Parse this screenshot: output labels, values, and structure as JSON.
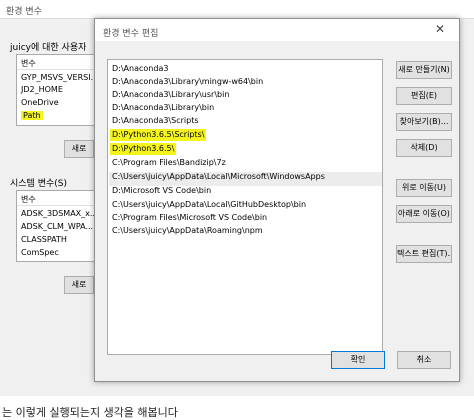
{
  "back_dialog": {
    "title": "환경 변수",
    "user_section_label": "juicy에 대한 사용자",
    "user_list_header": "변수",
    "user_vars": [
      "GYP_MSVS_VERSI...",
      "JD2_HOME",
      "OneDrive",
      "Path"
    ],
    "user_new_button": "새로",
    "system_section_label": "시스템 변수(S)",
    "system_list_header": "변수",
    "system_vars": [
      "ADSK_3DSMAX_x...",
      "ADSK_CLM_WPA...",
      "CLASSPATH",
      "ComSpec"
    ],
    "system_new_button": "새로"
  },
  "edit_dialog": {
    "title": "환경 변수 편집",
    "close_icon": "close-icon",
    "paths": [
      "D:\\Anaconda3",
      "D:\\Anaconda3\\Library\\mingw-w64\\bin",
      "D:\\Anaconda3\\Library\\usr\\bin",
      "D:\\Anaconda3\\Library\\bin",
      "D:\\Anaconda3\\Scripts",
      "D:\\Python3.6.5\\Scripts\\",
      "D:\\Python3.6.5\\",
      "C:\\Program Files\\Bandizip\\7z",
      "C:\\Users\\juicy\\AppData\\Local\\Microsoft\\WindowsApps",
      "D:\\Microsoft VS Code\\bin",
      "C:\\Users\\juicy\\AppData\\Local\\GitHubDesktop\\bin",
      "C:\\Program Files\\Microsoft VS Code\\bin",
      "C:\\Users\\juicy\\AppData\\Roaming\\npm"
    ],
    "buttons": {
      "new": "새로 만들기(N)",
      "edit": "편집(E)",
      "browse": "찾아보기(B)...",
      "delete": "삭제(D)",
      "move_up": "위로 이동(U)",
      "move_down": "아래로 이동(O)",
      "edit_text": "텍스트 편집(T)...",
      "ok": "확인",
      "cancel": "취소"
    }
  },
  "page_caption": "는 이렇게 실행되는지 생각을 해봅니다",
  "colors": {
    "highlight": "#f4f31c",
    "dialog_bg": "#f0f0f0",
    "primary_border": "#0078d7"
  }
}
